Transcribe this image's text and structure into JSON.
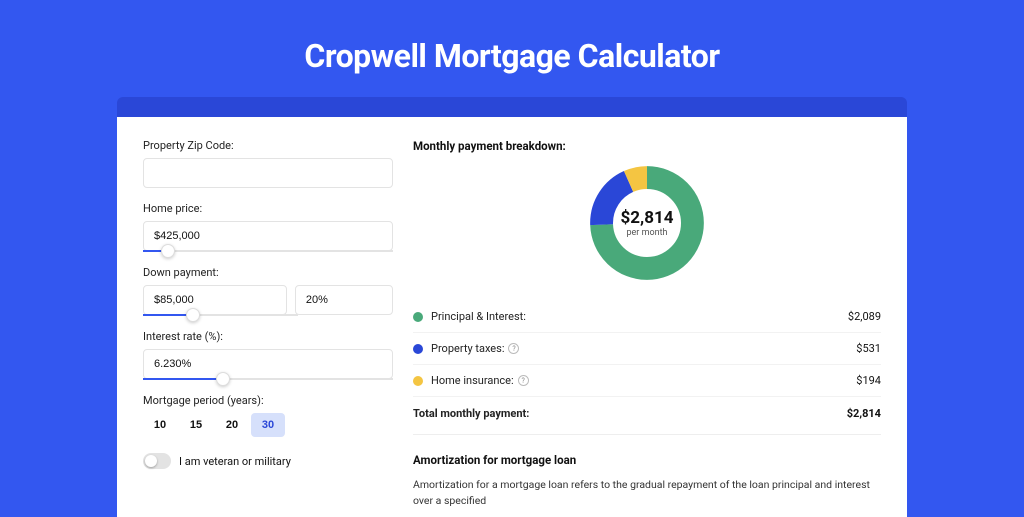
{
  "page_title": "Cropwell Mortgage Calculator",
  "form": {
    "zip": {
      "label": "Property Zip Code:",
      "value": ""
    },
    "home_price": {
      "label": "Home price:",
      "value": "$425,000",
      "slider_pct": 10
    },
    "down_payment": {
      "label": "Down payment:",
      "amount": "$85,000",
      "percent": "20%",
      "slider_pct": 20
    },
    "interest_rate": {
      "label": "Interest rate (%):",
      "value": "6.230%",
      "slider_pct": 32
    },
    "period": {
      "label": "Mortgage period (years):",
      "options": [
        "10",
        "15",
        "20",
        "30"
      ],
      "active": "30"
    },
    "veteran": {
      "label": "I am veteran or military"
    }
  },
  "breakdown": {
    "title": "Monthly payment breakdown:",
    "total_amount": "$2,814",
    "total_sub": "per month",
    "items": [
      {
        "label": "Principal & Interest:",
        "value": "$2,089",
        "color": "#49a97a",
        "info": false
      },
      {
        "label": "Property taxes:",
        "value": "$531",
        "color": "#2a47d7",
        "info": true
      },
      {
        "label": "Home insurance:",
        "value": "$194",
        "color": "#f4c542",
        "info": true
      }
    ],
    "total_row": {
      "label": "Total monthly payment:",
      "value": "$2,814"
    }
  },
  "chart_data": {
    "type": "pie",
    "title": "Monthly payment breakdown",
    "series": [
      {
        "name": "Principal & Interest",
        "value": 2089,
        "color": "#49a97a"
      },
      {
        "name": "Property taxes",
        "value": 531,
        "color": "#2a47d7"
      },
      {
        "name": "Home insurance",
        "value": 194,
        "color": "#f4c542"
      }
    ],
    "center_label": "$2,814",
    "center_sub": "per month"
  },
  "amortization": {
    "title": "Amortization for mortgage loan",
    "text": "Amortization for a mortgage loan refers to the gradual repayment of the loan principal and interest over a specified"
  }
}
